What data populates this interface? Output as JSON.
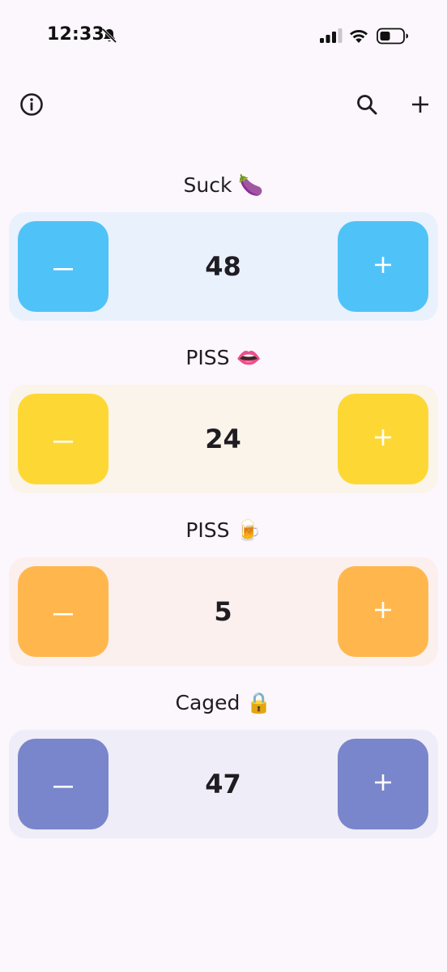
{
  "status_bar": {
    "time": "12:33"
  },
  "app_bar": {
    "icons": [
      "info-icon",
      "search-icon",
      "plus-icon"
    ]
  },
  "counters": [
    {
      "title": "Suck 🍆",
      "value": "48",
      "button_color": "#4fc3f7",
      "card_color": "#e9f1fd"
    },
    {
      "title": "PISS 👄",
      "value": "24",
      "button_color": "#fdd835",
      "card_color": "#fbf4ea"
    },
    {
      "title": "PISS 🍺",
      "value": "5",
      "button_color": "#ffb74d",
      "card_color": "#fbf0ee"
    },
    {
      "title": "Caged 🔒",
      "value": "47",
      "button_color": "#7986cb",
      "card_color": "#efedf7"
    }
  ],
  "colors": {
    "background": "#fcf7fd",
    "text": "#1f1c22"
  }
}
